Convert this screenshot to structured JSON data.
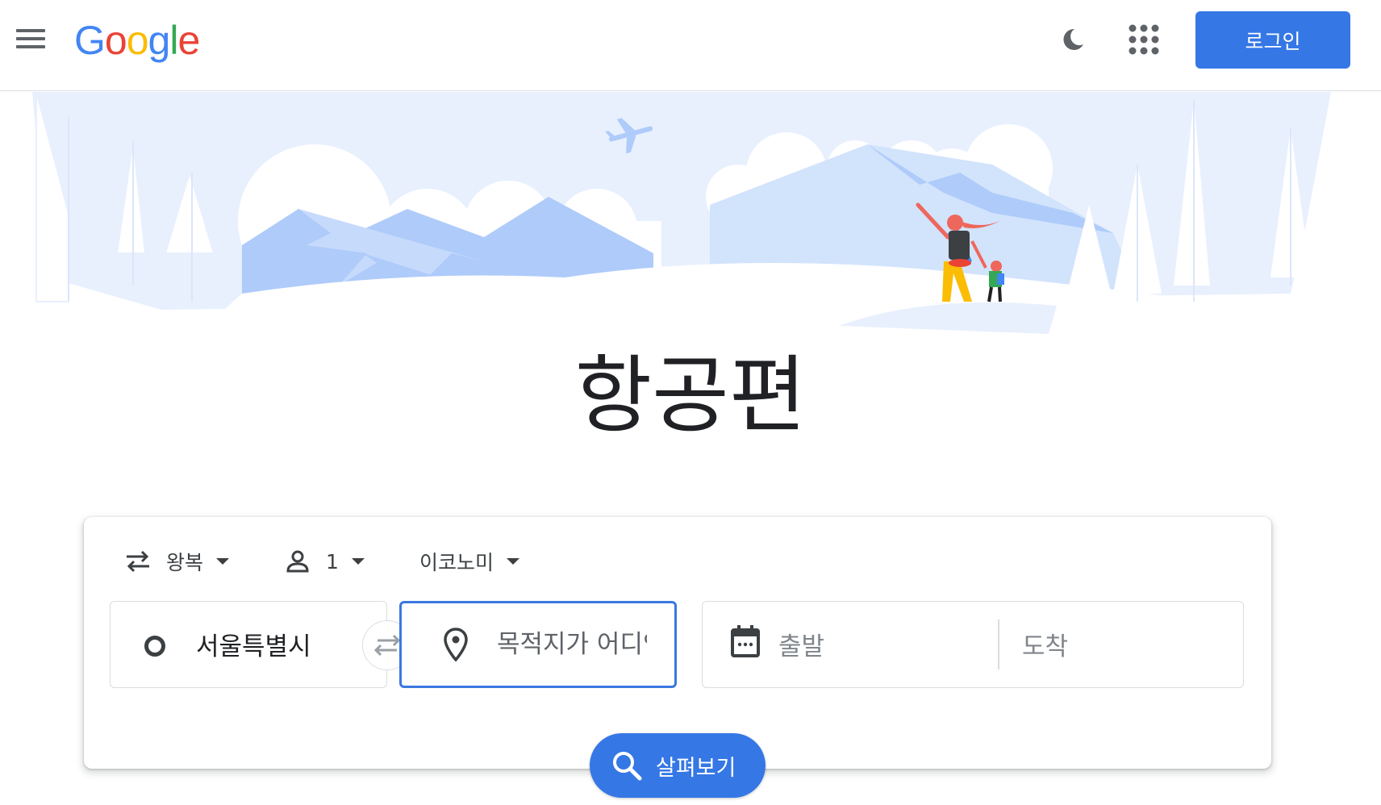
{
  "header": {
    "logo_text": "Google",
    "logo_colors": [
      "#4285F4",
      "#EA4335",
      "#FBBC05",
      "#4285F4",
      "#34A853",
      "#EA4335"
    ],
    "login_label": "로그인"
  },
  "hero": {
    "title": "항공편"
  },
  "search": {
    "trip_type": "왕복",
    "passengers": "1",
    "cabin_class": "이코노미",
    "origin": "서울특별시",
    "destination_placeholder": "목적지가 어디인가요?",
    "departure_label": "출발",
    "return_label": "도착",
    "search_label": "살펴보기"
  },
  "colors": {
    "accent": "#3577e5",
    "hero_sky": "#e8f0fe",
    "hero_mountain": "#aecbfa"
  }
}
